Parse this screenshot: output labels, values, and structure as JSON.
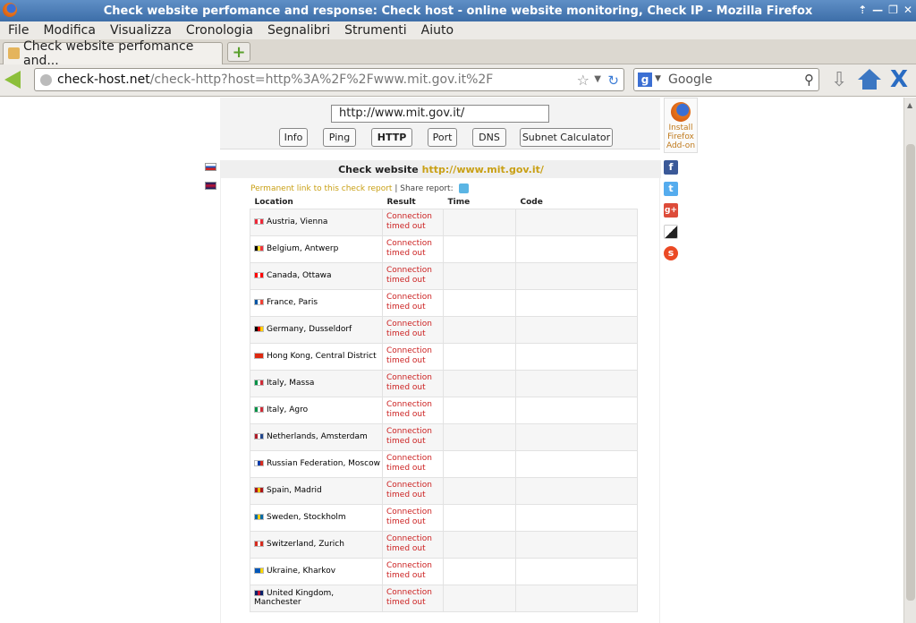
{
  "window": {
    "title": "Check website perfomance and response: Check host - online website monitoring, Check IP - Mozilla Firefox"
  },
  "menu": [
    "File",
    "Modifica",
    "Visualizza",
    "Cronologia",
    "Segnalibri",
    "Strumenti",
    "Aiuto"
  ],
  "tab": {
    "label": "Check website perfomance and..."
  },
  "urlbar": {
    "host": "check-host.net",
    "rest": "/check-http?host=http%3A%2F%2Fwww.mit.gov.it%2F"
  },
  "search": {
    "placeholder": "Google"
  },
  "page": {
    "host_input": "http://www.mit.gov.it/",
    "buttons": [
      "Info",
      "Ping",
      "HTTP",
      "Port",
      "DNS",
      "Subnet Calculator"
    ],
    "active_button": "HTTP",
    "addon": {
      "line1": "Install",
      "line2": "Firefox",
      "line3": "Add-on"
    },
    "check_title": "Check website",
    "check_url": "http://www.mit.gov.it/",
    "permanent_link": "Permanent link to this check report",
    "separator": "|",
    "share_report": "Share report:",
    "columns": [
      "Location",
      "Result",
      "Time",
      "Code"
    ],
    "rows": [
      {
        "location": "Austria, Vienna",
        "flag": [
          "#ed2939",
          "#ffffff",
          "#ed2939"
        ],
        "result1": "Connection",
        "result2": "timed out"
      },
      {
        "location": "Belgium, Antwerp",
        "flag": [
          "#000000",
          "#fdda24",
          "#ef3340"
        ],
        "result1": "Connection",
        "result2": "timed out"
      },
      {
        "location": "Canada, Ottawa",
        "flag": [
          "#ff0000",
          "#ffffff",
          "#ff0000"
        ],
        "result1": "Connection",
        "result2": "timed out"
      },
      {
        "location": "France, Paris",
        "flag": [
          "#0055a4",
          "#ffffff",
          "#ef4135"
        ],
        "result1": "Connection",
        "result2": "timed out"
      },
      {
        "location": "Germany, Dusseldorf",
        "flag": [
          "#000000",
          "#dd0000",
          "#ffce00"
        ],
        "result1": "Connection",
        "result2": "timed out"
      },
      {
        "location": "Hong Kong, Central District",
        "flag": [
          "#de2910",
          "#de2910",
          "#de2910"
        ],
        "result1": "Connection",
        "result2": "timed out"
      },
      {
        "location": "Italy, Massa",
        "flag": [
          "#009246",
          "#ffffff",
          "#ce2b37"
        ],
        "result1": "Connection",
        "result2": "timed out"
      },
      {
        "location": "Italy, Agro",
        "flag": [
          "#009246",
          "#ffffff",
          "#ce2b37"
        ],
        "result1": "Connection",
        "result2": "timed out"
      },
      {
        "location": "Netherlands, Amsterdam",
        "flag": [
          "#ae1c28",
          "#ffffff",
          "#21468b"
        ],
        "result1": "Connection",
        "result2": "timed out"
      },
      {
        "location": "Russian Federation, Moscow",
        "flag": [
          "#ffffff",
          "#0039a6",
          "#d52b1e"
        ],
        "result1": "Connection",
        "result2": "timed out"
      },
      {
        "location": "Spain, Madrid",
        "flag": [
          "#aa151b",
          "#f1bf00",
          "#aa151b"
        ],
        "result1": "Connection",
        "result2": "timed out"
      },
      {
        "location": "Sweden, Stockholm",
        "flag": [
          "#006aa7",
          "#fecc00",
          "#006aa7"
        ],
        "result1": "Connection",
        "result2": "timed out"
      },
      {
        "location": "Switzerland, Zurich",
        "flag": [
          "#d52b1e",
          "#ffffff",
          "#d52b1e"
        ],
        "result1": "Connection",
        "result2": "timed out"
      },
      {
        "location": "Ukraine, Kharkov",
        "flag": [
          "#0057b7",
          "#0057b7",
          "#ffd700"
        ],
        "result1": "Connection",
        "result2": "timed out"
      },
      {
        "location": "United Kingdom, Manchester",
        "flag": [
          "#012169",
          "#c8102e",
          "#012169"
        ],
        "result1": "Connection",
        "result2": "timed out"
      }
    ]
  },
  "social": [
    {
      "name": "facebook-icon",
      "glyph": "f",
      "color": "#3b5998"
    },
    {
      "name": "twitter-icon",
      "glyph": "t",
      "color": "#55acee"
    },
    {
      "name": "googleplus-icon",
      "glyph": "g+",
      "color": "#dd4b39"
    },
    {
      "name": "delicious-icon",
      "glyph": "",
      "color": "#222222"
    },
    {
      "name": "stumbleupon-icon",
      "glyph": "s",
      "color": "#eb4924"
    }
  ]
}
